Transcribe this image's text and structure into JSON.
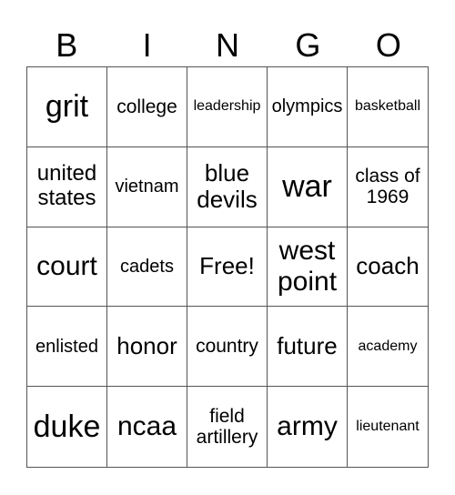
{
  "header": [
    "B",
    "I",
    "N",
    "G",
    "O"
  ],
  "cells": [
    "grit",
    "college",
    "leadership",
    "olympics",
    "basketball",
    "united states",
    "vietnam",
    "blue devils",
    "war",
    "class of 1969",
    "court",
    "cadets",
    "Free!",
    "west point",
    "coach",
    "enlisted",
    "honor",
    "country",
    "future",
    "academy",
    "duke",
    "ncaa",
    "field artillery",
    "army",
    "lieutenant"
  ]
}
